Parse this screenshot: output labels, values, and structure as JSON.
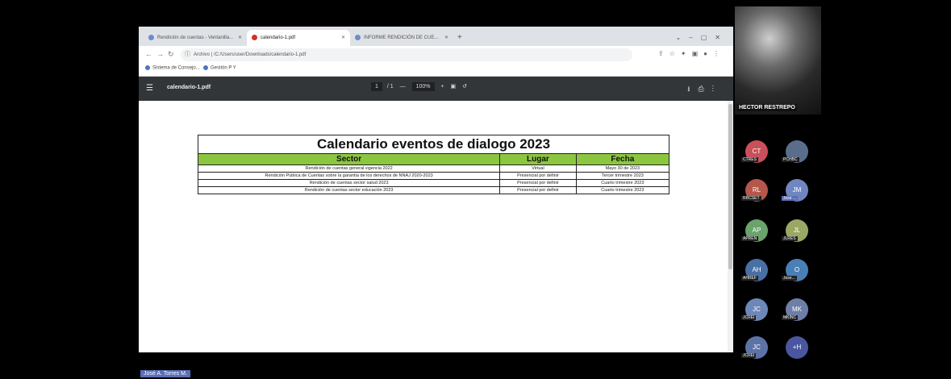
{
  "browser": {
    "tabs": [
      {
        "label": "Rendición de cuentas - Ventanilla..."
      },
      {
        "label": "calendario-1.pdf"
      },
      {
        "label": "INFORME RENDICIÓN DE CUE..."
      }
    ],
    "url": "Archivo | /C:/Users/user/Downloads/calendario-1.pdf",
    "bookmarks": [
      "Sistema de Consejo...",
      "Gestión P Y"
    ]
  },
  "pdf_viewer": {
    "filename": "calendario-1.pdf",
    "page": "1",
    "page_total": "/ 1",
    "zoom": "100%"
  },
  "calendar": {
    "title": "Calendario eventos de dialogo 2023",
    "headers": {
      "sector": "Sector",
      "lugar": "Lugar",
      "fecha": "Fecha"
    },
    "rows": [
      {
        "sector": "Rendición de cuentas general vigencia 2022",
        "lugar": "Virtual",
        "fecha": "Mayo 30 de 2023"
      },
      {
        "sector": "Rendición Pública de Cuentas sobre la garantía de los derechos de NNAJ 2020-2023",
        "lugar": "Presencial por definir",
        "fecha": "Tercer trimestre 2023"
      },
      {
        "sector": "Rendición de cuentas sector salud 2023",
        "lugar": "Presencial por definir",
        "fecha": "Cuarto trimestre 2023"
      },
      {
        "sector": "Rendición de cuentas sector educación 2023",
        "lugar": "Presencial por definir",
        "fecha": "Cuarto trimestre 2023"
      }
    ],
    "header_color": "#8cc63f"
  },
  "meeting": {
    "featured_name": "HECTOR RESTREPO",
    "participants": [
      {
        "initials": "CT",
        "label": "CTRES",
        "color": "#c9505a"
      },
      {
        "initials": "",
        "label": "PCHBC",
        "color": "#5a6e8c"
      },
      {
        "initials": "RL",
        "label": "RRCSET",
        "color": "#b5574b"
      },
      {
        "initials": "JM",
        "label": "Jose ...",
        "color": "#6f86c1"
      },
      {
        "initials": "AP",
        "label": "APREN",
        "color": "#6aa36b"
      },
      {
        "initials": "JL",
        "label": "JLRES",
        "color": "#9aa865"
      },
      {
        "initials": "AH",
        "label": "AHREF",
        "color": "#4a6fa5"
      },
      {
        "initials": "O",
        "label": "Jose...",
        "color": "#4a7fb5"
      },
      {
        "initials": "JC",
        "label": "JCREI",
        "color": "#6d87b9"
      },
      {
        "initials": "MK",
        "label": "MKINC",
        "color": "#6d7ea8"
      },
      {
        "initials": "JC",
        "label": "JCREI",
        "color": "#5d73a8"
      },
      {
        "initials": "+H",
        "label": "",
        "color": "#4a56a0"
      }
    ],
    "presenter_name": "José A. Torres M."
  }
}
